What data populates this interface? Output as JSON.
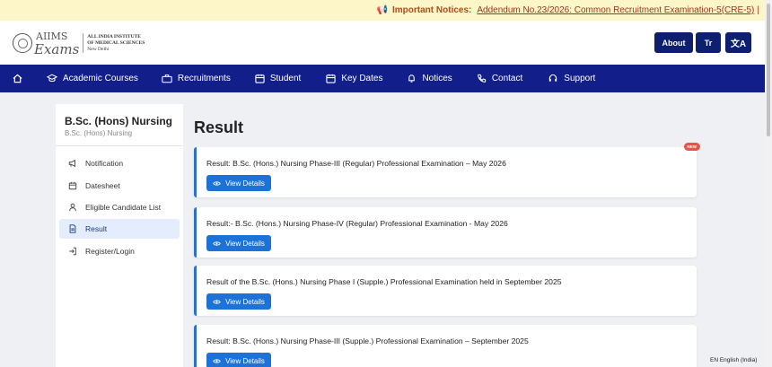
{
  "notice": {
    "title": "Important Notices:",
    "link": "Addendum No.23/2026: Common Recruitment Examination-5(CRE-5)",
    "separator": "|"
  },
  "header": {
    "logo_script": "Exams",
    "logo_aiims": "AIIMS",
    "logo_line1": "ALL INDIA INSTITUTE",
    "logo_line2": "OF MEDICAL SCIENCES",
    "logo_line3": "New Delhi",
    "about_label": "About",
    "font_label": "Tr",
    "lang_label": "文A"
  },
  "nav": {
    "items": [
      {
        "label": "Academic Courses",
        "icon": "graduation-cap-icon"
      },
      {
        "label": "Recruitments",
        "icon": "briefcase-icon"
      },
      {
        "label": "Student",
        "icon": "calendar-user-icon"
      },
      {
        "label": "Key Dates",
        "icon": "calendar-icon"
      },
      {
        "label": "Notices",
        "icon": "bell-icon"
      },
      {
        "label": "Contact",
        "icon": "phone-icon"
      },
      {
        "label": "Support",
        "icon": "headset-icon"
      }
    ]
  },
  "sidebar": {
    "title": "B.Sc. (Hons) Nursing",
    "subtitle": "B.Sc. (Hons) Nursing",
    "items": [
      {
        "label": "Notification",
        "icon": "megaphone-icon"
      },
      {
        "label": "Datesheet",
        "icon": "calendar-icon"
      },
      {
        "label": "Eligible Candidate List",
        "icon": "user-icon"
      },
      {
        "label": "Result",
        "icon": "document-icon"
      },
      {
        "label": "Register/Login",
        "icon": "login-icon"
      }
    ],
    "active_index": 3
  },
  "main": {
    "title": "Result",
    "view_label": "View Details",
    "badge": "NEW",
    "results": [
      {
        "title": "Result: B.Sc. (Hons.) Nursing Phase-III (Regular) Professional Examination – May 2026",
        "is_new": true
      },
      {
        "title": "Result:- B.Sc. (Hons.) Nursing Phase-IV (Regular) Professional Examination - May 2026",
        "is_new": false
      },
      {
        "title": "Result of the B.Sc. (Hons.) Nursing Phase I (Supple.) Professional Examination held in September 2025",
        "is_new": false
      },
      {
        "title": "Result: B.Sc. (Hons.) Nursing Phase-III (Supple.) Professional Examination – September 2025",
        "is_new": false
      }
    ]
  },
  "footer": {
    "language": "EN English (India)"
  },
  "colors": {
    "navy": "#121f8a",
    "button_blue": "#1d72d8",
    "notice_bg": "#fdf6c8",
    "badge_red": "#e2574c"
  }
}
